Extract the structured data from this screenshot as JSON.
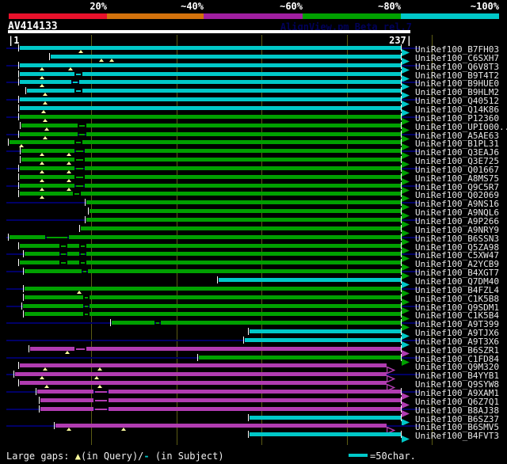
{
  "header": {
    "query_name": "AV414133",
    "watermark": "AlignView.pm Beta rel.7"
  },
  "scale_bar": {
    "labels": [
      "20%",
      "~40%",
      "~60%",
      "~80%",
      "~100%"
    ],
    "colors": [
      "#e8112b",
      "#d2720c",
      "#a01fa0",
      "#00a000",
      "#00c8c8"
    ]
  },
  "ruler": {
    "left_label": "|1",
    "right_label": "237|"
  },
  "legend": {
    "large_gaps_label": "Large gaps: ",
    "query_gap_symbol": "▲",
    "query_gap_text": "(in Query)/",
    "subject_gap_symbol": "-",
    "subject_gap_text": " (in Subject)",
    "scale_unit_text": "=50char."
  },
  "colors": {
    "background": "#000000",
    "cyan": "#00c8c8",
    "green": "#00a000",
    "purple": "#b13cb1",
    "navy": "#000066",
    "grid": "#5c5c14",
    "gap_triangle": "#ffffa0",
    "label_text": "#e8e8e8",
    "white": "#ffffff"
  },
  "chart_data": {
    "type": "alignment-overview",
    "title": "AV414133",
    "query_start": 1,
    "query_end": 237,
    "axis_ticks": [
      50,
      100,
      150,
      200,
      250
    ],
    "identity_legend": [
      {
        "label": "20%",
        "color": "#e8112b"
      },
      {
        "label": "~40%",
        "color": "#d2720c"
      },
      {
        "label": "~60%",
        "color": "#a01fa0"
      },
      {
        "label": "~80%",
        "color": "#00a000"
      },
      {
        "label": "~100%",
        "color": "#00c8c8"
      }
    ],
    "rows": [
      {
        "label": "UniRef100_B7FH03",
        "color": "cyan",
        "start": 8,
        "end": 237,
        "tri": [
          44
        ],
        "thin": [],
        "hollow": false
      },
      {
        "label": "UniRef100_C6SXH7",
        "color": "cyan",
        "start": 26,
        "end": 237,
        "tri": [
          56,
          62
        ],
        "thin": [],
        "hollow": false
      },
      {
        "label": "UniRef100_Q6V8T3",
        "color": "cyan",
        "start": 8,
        "end": 237,
        "tri": [
          21,
          38
        ],
        "thin": [],
        "hollow": false
      },
      {
        "label": "UniRef100_B9T4T2",
        "color": "cyan",
        "start": 8,
        "end": 237,
        "tri": [
          21
        ],
        "thin": [
          [
            41,
            44
          ]
        ],
        "hollow": false
      },
      {
        "label": "UniRef100_B9HUE0",
        "color": "cyan",
        "start": 8,
        "end": 237,
        "tri": [
          21
        ],
        "thin": [
          [
            39,
            42
          ]
        ],
        "hollow": false
      },
      {
        "label": "UniRef100_B9HLM2",
        "color": "cyan",
        "start": 12,
        "end": 237,
        "tri": [
          23
        ],
        "thin": [
          [
            41,
            44
          ]
        ],
        "hollow": false
      },
      {
        "label": "UniRef100_Q40512",
        "color": "cyan",
        "start": 8,
        "end": 237,
        "tri": [
          23
        ],
        "thin": [],
        "hollow": false
      },
      {
        "label": "UniRef100_Q14K86",
        "color": "cyan",
        "start": 8,
        "end": 237,
        "tri": [
          22
        ],
        "thin": [],
        "hollow": false
      },
      {
        "label": "UniRef100_P12360",
        "color": "green",
        "start": 8,
        "end": 237,
        "tri": [
          23
        ],
        "thin": [],
        "hollow": false
      },
      {
        "label": "UniRef100_UPI000..",
        "color": "green",
        "start": 9,
        "end": 237,
        "tri": [
          24
        ],
        "thin": [
          [
            43,
            46
          ]
        ],
        "hollow": false
      },
      {
        "label": "UniRef100_A5AE63",
        "color": "green",
        "start": 8,
        "end": 237,
        "tri": [
          23
        ],
        "thin": [
          [
            43,
            46
          ]
        ],
        "hollow": false
      },
      {
        "label": "UniRef100_B1PL31",
        "color": "green",
        "start": 2,
        "end": 237,
        "tri": [
          9
        ],
        "thin": [
          [
            41,
            44
          ]
        ],
        "hollow": false
      },
      {
        "label": "UniRef100_Q3EAJ6",
        "color": "green",
        "start": 9,
        "end": 237,
        "tri": [
          21,
          37
        ],
        "thin": [
          [
            41,
            45
          ]
        ],
        "hollow": false
      },
      {
        "label": "UniRef100_Q3E725",
        "color": "green",
        "start": 9,
        "end": 237,
        "tri": [
          21,
          37
        ],
        "thin": [
          [
            41,
            45
          ]
        ],
        "hollow": false
      },
      {
        "label": "UniRef100_Q01667",
        "color": "green",
        "start": 8,
        "end": 237,
        "tri": [
          21,
          37
        ],
        "thin": [
          [
            41,
            45
          ]
        ],
        "hollow": false
      },
      {
        "label": "UniRef100_A8MS75",
        "color": "green",
        "start": 8,
        "end": 237,
        "tri": [
          21,
          37
        ],
        "thin": [
          [
            41,
            45
          ]
        ],
        "hollow": false
      },
      {
        "label": "UniRef100_Q9C5R7",
        "color": "green",
        "start": 8,
        "end": 237,
        "tri": [
          21,
          37
        ],
        "thin": [
          [
            41,
            45
          ]
        ],
        "hollow": false
      },
      {
        "label": "UniRef100_Q02069",
        "color": "green",
        "start": 8,
        "end": 237,
        "tri": [
          21
        ],
        "thin": [
          [
            40,
            43
          ]
        ],
        "hollow": false
      },
      {
        "label": "UniRef100_A9NS16",
        "color": "green",
        "start": 47,
        "end": 237,
        "tri": [],
        "thin": [],
        "hollow": false
      },
      {
        "label": "UniRef100_A9NQL6",
        "color": "green",
        "start": 49,
        "end": 237,
        "tri": [],
        "thin": [],
        "hollow": false
      },
      {
        "label": "UniRef100_A9P266",
        "color": "green",
        "start": 47,
        "end": 237,
        "tri": [],
        "thin": [],
        "hollow": false
      },
      {
        "label": "UniRef100_A9NRY9",
        "color": "green",
        "start": 44,
        "end": 237,
        "tri": [],
        "thin": [],
        "hollow": false
      },
      {
        "label": "UniRef100_B6SSN3",
        "color": "green",
        "start": 2,
        "end": 237,
        "tri": [],
        "thin": [
          [
            24,
            36
          ]
        ],
        "hollow": false
      },
      {
        "label": "UniRef100_Q5ZA98",
        "color": "green",
        "start": 8,
        "end": 237,
        "tri": [],
        "thin": [
          [
            32,
            35
          ],
          [
            44,
            46
          ]
        ],
        "hollow": false
      },
      {
        "label": "UniRef100_C5XW47",
        "color": "green",
        "start": 11,
        "end": 237,
        "tri": [],
        "thin": [
          [
            32,
            35
          ],
          [
            44,
            46
          ]
        ],
        "hollow": false
      },
      {
        "label": "UniRef100_A2YCB9",
        "color": "green",
        "start": 8,
        "end": 237,
        "tri": [],
        "thin": [
          [
            32,
            35
          ],
          [
            44,
            46
          ]
        ],
        "hollow": false
      },
      {
        "label": "UniRef100_B4XGT7",
        "color": "green",
        "start": 11,
        "end": 237,
        "tri": [],
        "thin": [
          [
            45,
            47
          ]
        ],
        "hollow": false
      },
      {
        "label": "UniRef100_Q7DM40",
        "color": "cyan",
        "start": 125,
        "end": 237,
        "tri": [],
        "thin": [],
        "hollow": false
      },
      {
        "label": "UniRef100_B4FZL4",
        "color": "green",
        "start": 11,
        "end": 237,
        "tri": [
          43
        ],
        "thin": [],
        "hollow": false
      },
      {
        "label": "UniRef100_C1K5B8",
        "color": "green",
        "start": 11,
        "end": 237,
        "tri": [],
        "thin": [
          [
            46,
            48
          ]
        ],
        "hollow": false
      },
      {
        "label": "UniRef100_Q9SDM1",
        "color": "green",
        "start": 10,
        "end": 237,
        "tri": [],
        "thin": [
          [
            46,
            48
          ]
        ],
        "hollow": false
      },
      {
        "label": "UniRef100_C1K5B4",
        "color": "green",
        "start": 11,
        "end": 237,
        "tri": [],
        "thin": [
          [
            46,
            48
          ]
        ],
        "hollow": false
      },
      {
        "label": "UniRef100_A9T399",
        "color": "green",
        "start": 62,
        "end": 237,
        "tri": [],
        "thin": [
          [
            88,
            90
          ]
        ],
        "hollow": false
      },
      {
        "label": "UniRef100_A9TJX6",
        "color": "cyan",
        "start": 143,
        "end": 237,
        "tri": [],
        "thin": [],
        "hollow": false
      },
      {
        "label": "UniRef100_A9T3X6",
        "color": "cyan",
        "start": 140,
        "end": 237,
        "tri": [],
        "thin": [],
        "hollow": false
      },
      {
        "label": "UniRef100_B6SZR1",
        "color": "purple",
        "start": 14,
        "end": 237,
        "tri": [
          36
        ],
        "thin": [
          [
            41,
            46
          ]
        ],
        "hollow": false
      },
      {
        "label": "UniRef100_C1FD84",
        "color": "green",
        "start": 113,
        "end": 237,
        "tri": [],
        "thin": [],
        "hollow": false
      },
      {
        "label": "UniRef100_Q9M320",
        "color": "purple",
        "start": 8,
        "end": 228,
        "tri": [
          23,
          55
        ],
        "thin": [],
        "hollow": true
      },
      {
        "label": "UniRef100_B4YYB1",
        "color": "purple",
        "start": 5,
        "end": 228,
        "tri": [
          21,
          53
        ],
        "thin": [],
        "hollow": true
      },
      {
        "label": "UniRef100_Q9SYW8",
        "color": "purple",
        "start": 8,
        "end": 228,
        "tri": [
          24,
          55
        ],
        "thin": [],
        "hollow": true
      },
      {
        "label": "UniRef100_A9XAM1",
        "color": "purple",
        "start": 18,
        "end": 237,
        "tri": [],
        "thin": [
          [
            52,
            59
          ]
        ],
        "hollow": false
      },
      {
        "label": "UniRef100_Q6Z7Q1",
        "color": "purple",
        "start": 20,
        "end": 237,
        "tri": [],
        "thin": [
          [
            52,
            59
          ]
        ],
        "hollow": false
      },
      {
        "label": "UniRef100_B8AJ38",
        "color": "purple",
        "start": 20,
        "end": 237,
        "tri": [],
        "thin": [
          [
            52,
            59
          ]
        ],
        "hollow": false
      },
      {
        "label": "UniRef100_B6SZ37",
        "color": "cyan",
        "start": 143,
        "end": 237,
        "tri": [],
        "thin": [],
        "hollow": false
      },
      {
        "label": "UniRef100_B6SMV5",
        "color": "purple",
        "start": 29,
        "end": 228,
        "tri": [
          37,
          69
        ],
        "thin": [],
        "hollow": true
      },
      {
        "label": "UniRef100_B4FVT3",
        "color": "cyan",
        "start": 143,
        "end": 237,
        "tri": [],
        "thin": [],
        "hollow": false
      }
    ]
  }
}
